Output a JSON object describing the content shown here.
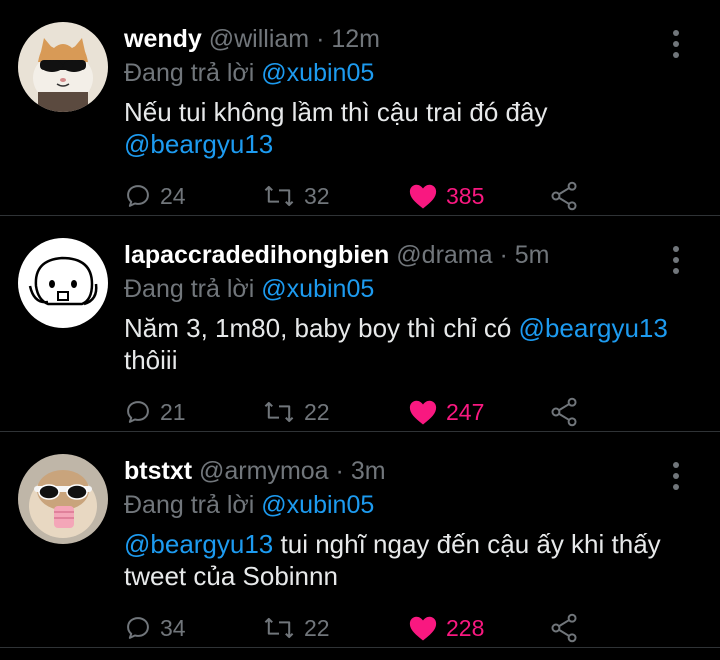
{
  "tweets": [
    {
      "name": "wendy",
      "handle": "@william",
      "time": "12m",
      "reply_prefix": "Đang trả lời",
      "reply_to": "@xubin05",
      "body_text": "Nếu tui không lầm thì cậu trai đó đây",
      "body_mention": "@beargyu13",
      "replies": "24",
      "retweets": "32",
      "likes": "385",
      "avatar": "cat-with-sunglasses"
    },
    {
      "name": "lapaccradedihongbien",
      "handle": "@drama",
      "time": "5m",
      "reply_prefix": "Đang trả lời",
      "reply_to": "@xubin05",
      "body_text": "Năm 3, 1m80, baby boy thì chỉ có",
      "body_mention": "@beargyu13",
      "body_tail": "thôiii",
      "replies": "21",
      "retweets": "22",
      "likes": "247",
      "avatar": "doodle-blob-character"
    },
    {
      "name": "btstxt",
      "handle": "@armymoa",
      "time": "3m",
      "reply_prefix": "Đang trả lời",
      "reply_to": "@xubin05",
      "body_mention": "@beargyu13",
      "body_text": "tui nghĩ ngay đến cậu ấy khi thấy tweet của Sobinnn",
      "replies": "34",
      "retweets": "22",
      "likes": "228",
      "avatar": "hamster-with-sunglasses"
    }
  ],
  "separator": "·",
  "colors": {
    "background": "#000000",
    "secondary": "#71767b",
    "mention": "#1d9bf0",
    "like": "#f91880",
    "divider": "#2f3336"
  }
}
